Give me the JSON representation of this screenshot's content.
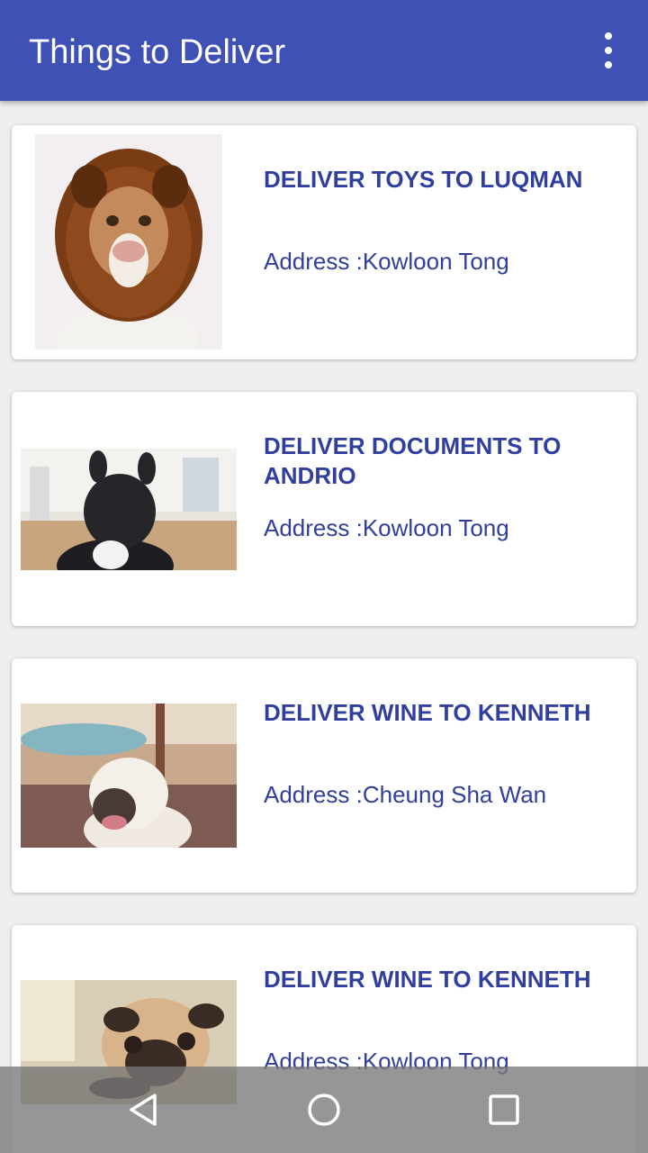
{
  "appbar": {
    "title": "Things to Deliver",
    "background": "#3f51b5",
    "menu_icon": "overflow-menu-icon"
  },
  "deliveries": [
    {
      "title": "DELIVER TOYS TO LUQMAN",
      "address": "Address :Kowloon Tong",
      "image": "dog-in-lion-hood-photo"
    },
    {
      "title": "DELIVER DOCUMENTS TO ANDRIO",
      "address": "Address :Kowloon Tong",
      "image": "french-bulldog-photo"
    },
    {
      "title": "DELIVER WINE TO KENNETH",
      "address": "Address :Cheung Sha Wan",
      "image": "bull-terrier-poolside-photo"
    },
    {
      "title": "DELIVER WINE TO KENNETH",
      "address": "Address :Kowloon Tong",
      "image": "pug-on-blanket-photo"
    }
  ],
  "colors": {
    "accent_text": "#303f9f",
    "page_background": "#efefef"
  },
  "navbar": {
    "back_icon": "back-triangle-icon",
    "home_icon": "home-circle-icon",
    "recents_icon": "recents-square-icon"
  }
}
